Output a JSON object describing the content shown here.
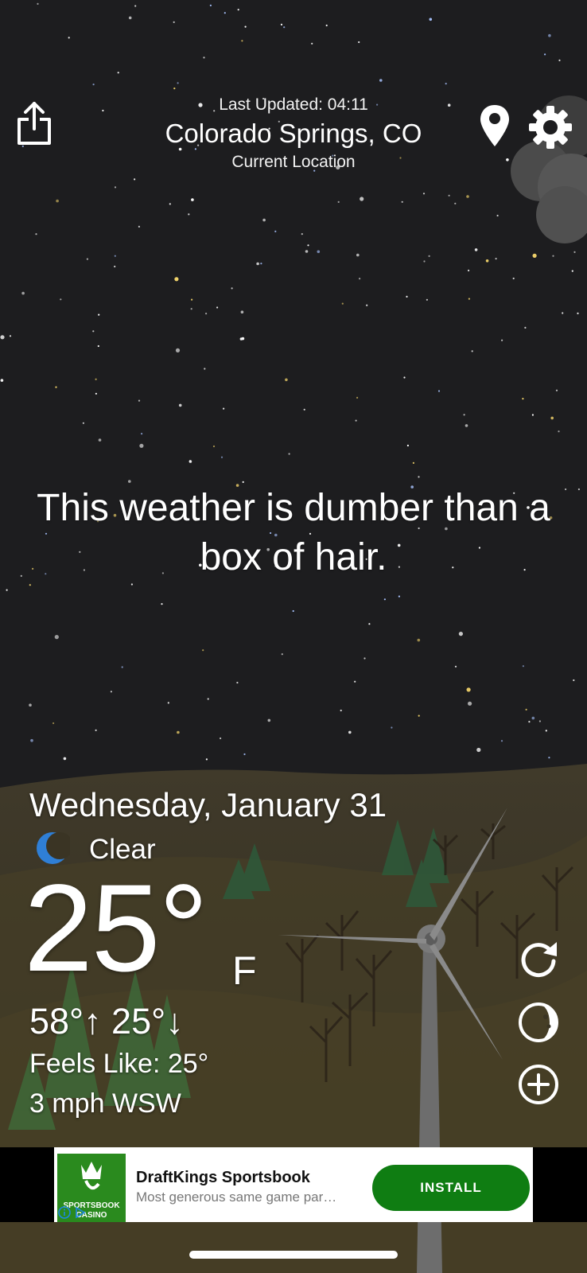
{
  "header": {
    "last_updated": "Last Updated: 04:11",
    "city": "Colorado Springs, CO",
    "location_label": "Current Location"
  },
  "quote": "This weather is dumber than a box of hair.",
  "weather": {
    "date": "Wednesday, January 31",
    "condition": "Clear",
    "temperature": "25°",
    "unit": "F",
    "hi_lo": "58°↑ 25°↓",
    "feels_like": "Feels Like: 25°",
    "wind": "3 mph WSW"
  },
  "icons": {
    "share": "share-icon",
    "location": "map-pin-icon",
    "settings": "gear-icon",
    "condition": "crescent-moon-icon",
    "refresh": "refresh-icon",
    "moon_phase": "moon-phase-icon",
    "add": "plus-circle-icon"
  },
  "ad": {
    "title": "DraftKings Sportsbook",
    "subtitle": "Most generous same game par…",
    "cta": "INSTALL",
    "logo_text": "SPORTSBOOK CASINO",
    "cta_color": "#0f7d12",
    "logo_color": "#2a8a1e"
  },
  "colors": {
    "sky": "#1d1d1f",
    "ground": "#3b3424",
    "moon_icon": "#2f7fd6"
  }
}
